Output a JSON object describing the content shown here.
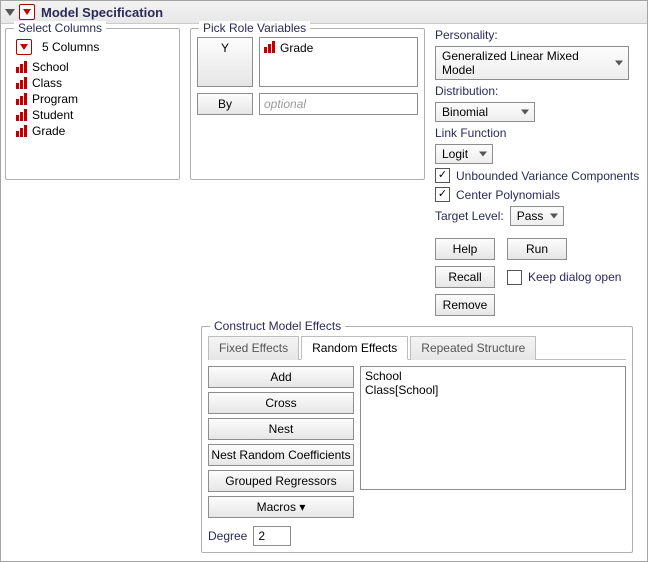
{
  "header": {
    "title": "Model Specification"
  },
  "select_columns": {
    "legend": "Select Columns",
    "count_label": "5 Columns",
    "items": [
      "School",
      "Class",
      "Program",
      "Student",
      "Grade"
    ]
  },
  "pick_role": {
    "legend": "Pick Role Variables",
    "y_label": "Y",
    "y_item": "Grade",
    "by_label": "By",
    "by_placeholder": "optional"
  },
  "right": {
    "personality_label": "Personality:",
    "personality_value": "Generalized Linear Mixed Model",
    "distribution_label": "Distribution:",
    "distribution_value": "Binomial",
    "link_label": "Link Function",
    "link_value": "Logit",
    "unbounded_label": "Unbounded Variance Components",
    "center_label": "Center Polynomials",
    "target_level_label": "Target Level:",
    "target_level_value": "Pass",
    "help": "Help",
    "run": "Run",
    "recall": "Recall",
    "keep_open": "Keep dialog open",
    "remove": "Remove"
  },
  "construct": {
    "legend": "Construct Model Effects",
    "tabs": [
      "Fixed Effects",
      "Random Effects",
      "Repeated Structure"
    ],
    "active_tab": 1,
    "buttons": [
      "Add",
      "Cross",
      "Nest",
      "Nest Random Coefficients",
      "Grouped Regressors",
      "Macros ▾"
    ],
    "effects": [
      "School",
      "Class[School]"
    ],
    "degree_label": "Degree",
    "degree_value": "2"
  }
}
